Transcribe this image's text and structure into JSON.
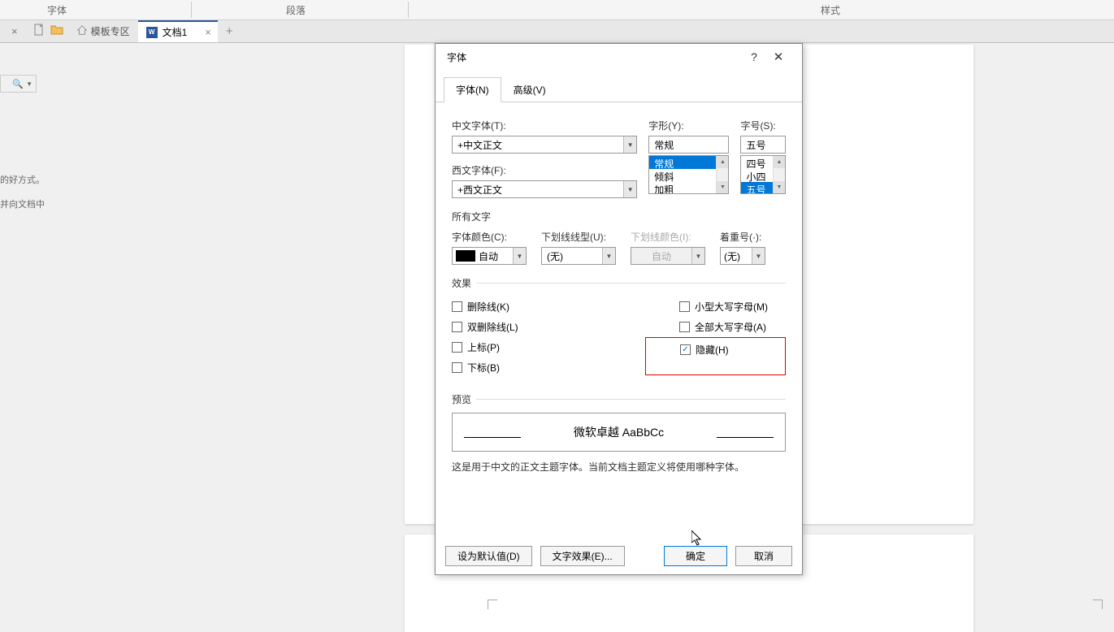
{
  "ribbon": {
    "font_group": "字体",
    "paragraph_group": "段落",
    "styles_group": "样式"
  },
  "tabs": {
    "template": "模板专区",
    "doc_name": "文档1",
    "doc_icon": "W",
    "close": "×",
    "add": "+"
  },
  "left": {
    "hint1": "的好方式。",
    "hint2": "并向文档中"
  },
  "dialog": {
    "title": "字体",
    "help": "?",
    "close": "✕",
    "tab_font": "字体(N)",
    "tab_advanced": "高级(V)",
    "cn_font_label": "中文字体(T):",
    "cn_font_value": "+中文正文",
    "en_font_label": "西文字体(F):",
    "en_font_value": "+西文正文",
    "style_label": "字形(Y):",
    "style_value": "常规",
    "style_options": [
      "常规",
      "倾斜",
      "加粗"
    ],
    "size_label": "字号(S):",
    "size_value": "五号",
    "size_options": [
      "四号",
      "小四",
      "五号"
    ],
    "all_text": "所有文字",
    "color_label": "字体颜色(C):",
    "color_value": "自动",
    "underline_label": "下划线线型(U):",
    "underline_value": "(无)",
    "underline_color_label": "下划线颜色(I):",
    "underline_color_value": "自动",
    "emphasis_label": "着重号(·):",
    "emphasis_value": "(无)",
    "effects": "效果",
    "cb_strike": "删除线(K)",
    "cb_dblstrike": "双删除线(L)",
    "cb_super": "上标(P)",
    "cb_sub": "下标(B)",
    "cb_smallcaps": "小型大写字母(M)",
    "cb_allcaps": "全部大写字母(A)",
    "cb_hidden": "隐藏(H)",
    "preview_label": "预览",
    "preview_text": "微软卓越 AaBbCc",
    "hint": "这是用于中文的正文主题字体。当前文档主题定义将使用哪种字体。",
    "btn_default": "设为默认值(D)",
    "btn_texteffects": "文字效果(E)...",
    "btn_ok": "确定",
    "btn_cancel": "取消"
  }
}
